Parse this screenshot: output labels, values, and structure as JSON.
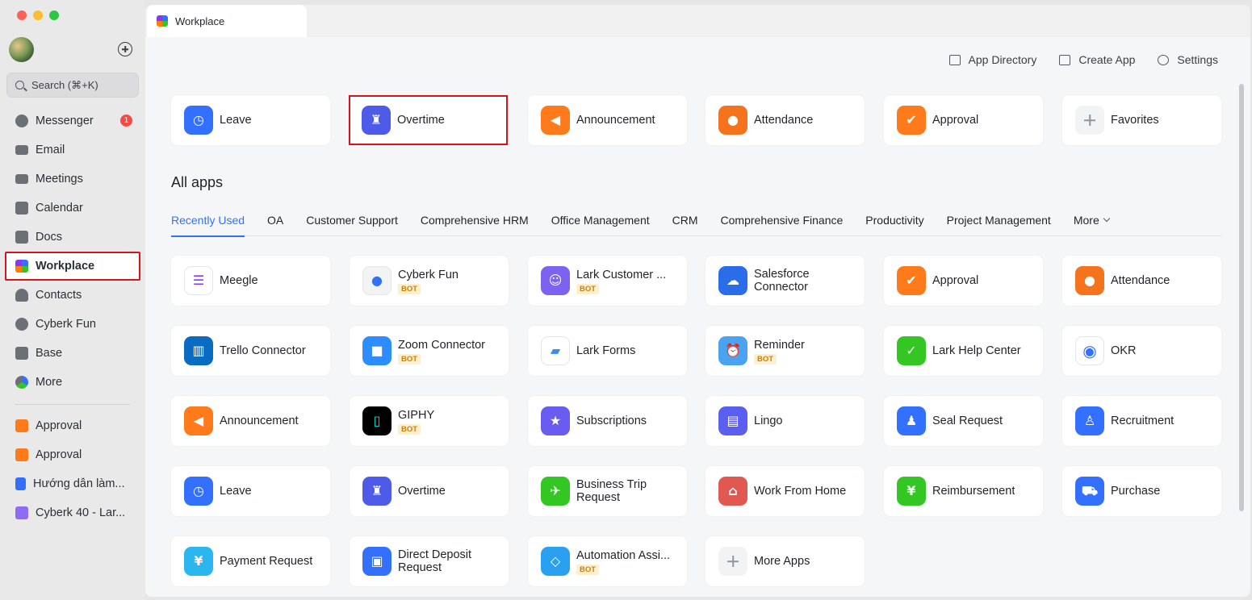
{
  "sidebar": {
    "search_placeholder": "Search (⌘+K)",
    "items": [
      {
        "label": "Messenger",
        "badge": "1"
      },
      {
        "label": "Email"
      },
      {
        "label": "Meetings"
      },
      {
        "label": "Calendar"
      },
      {
        "label": "Docs"
      },
      {
        "label": "Workplace"
      },
      {
        "label": "Contacts"
      },
      {
        "label": "Cyberk Fun"
      },
      {
        "label": "Base"
      },
      {
        "label": "More"
      }
    ],
    "pinned": [
      {
        "label": "Approval"
      },
      {
        "label": "Approval"
      },
      {
        "label": "Hướng dẫn làm..."
      },
      {
        "label": "Cyberk 40 - Lar..."
      }
    ]
  },
  "tab": {
    "label": "Workplace"
  },
  "topbar": {
    "app_directory": "App Directory",
    "create_app": "Create App",
    "settings": "Settings"
  },
  "favorites": [
    {
      "label": "Leave"
    },
    {
      "label": "Overtime"
    },
    {
      "label": "Announcement"
    },
    {
      "label": "Attendance"
    },
    {
      "label": "Approval"
    },
    {
      "label": "Favorites"
    }
  ],
  "all_apps": {
    "title": "All apps",
    "categories": [
      "Recently Used",
      "OA",
      "Customer Support",
      "Comprehensive HRM",
      "Office Management",
      "CRM",
      "Comprehensive Finance",
      "Productivity",
      "Project Management",
      "More"
    ],
    "bot_label": "BOT",
    "apps": [
      {
        "label": "Meegle"
      },
      {
        "label": "Cyberk Fun",
        "bot": true
      },
      {
        "label": "Lark Customer ...",
        "bot": true
      },
      {
        "label": "Salesforce Connector"
      },
      {
        "label": "Approval"
      },
      {
        "label": "Attendance"
      },
      {
        "label": "Trello Connector"
      },
      {
        "label": "Zoom Connector",
        "bot": true
      },
      {
        "label": "Lark Forms"
      },
      {
        "label": "Reminder",
        "bot": true
      },
      {
        "label": "Lark Help Center"
      },
      {
        "label": "OKR"
      },
      {
        "label": "Announcement"
      },
      {
        "label": "GIPHY",
        "bot": true
      },
      {
        "label": "Subscriptions"
      },
      {
        "label": "Lingo"
      },
      {
        "label": "Seal Request"
      },
      {
        "label": "Recruitment"
      },
      {
        "label": "Leave"
      },
      {
        "label": "Overtime"
      },
      {
        "label": "Business Trip Request"
      },
      {
        "label": "Work From Home"
      },
      {
        "label": "Reimbursement"
      },
      {
        "label": "Purchase"
      },
      {
        "label": "Payment Request"
      },
      {
        "label": "Direct Deposit Request"
      },
      {
        "label": "Automation Assi...",
        "bot": true
      },
      {
        "label": "More Apps"
      }
    ]
  }
}
